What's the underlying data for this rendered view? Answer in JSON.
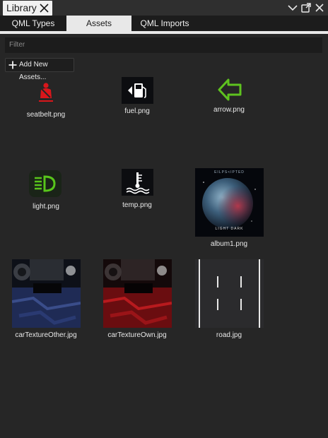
{
  "window": {
    "title": "Library"
  },
  "tabs": [
    {
      "label": "QML Types",
      "active": false
    },
    {
      "label": "Assets",
      "active": true
    },
    {
      "label": "QML Imports",
      "active": false
    }
  ],
  "filter": {
    "placeholder": "Filter"
  },
  "toolbar": {
    "add_label": "Add New Assets..."
  },
  "assets": [
    {
      "name": "seatbelt.png",
      "icon": "seatbelt-warning-icon"
    },
    {
      "name": "fuel.png",
      "icon": "fuel-icon"
    },
    {
      "name": "arrow.png",
      "icon": "arrow-left-icon"
    },
    {
      "name": "light.png",
      "icon": "headlight-icon"
    },
    {
      "name": "temp.png",
      "icon": "temperature-icon"
    },
    {
      "name": "album1.png",
      "icon": "album-cover-image",
      "album_text_top": "EILPS<IPTED",
      "album_text_bottom": "LIGHT DARK"
    },
    {
      "name": "carTextureOther.jpg",
      "icon": "car-texture-blue-image"
    },
    {
      "name": "carTextureOwn.jpg",
      "icon": "car-texture-red-image"
    },
    {
      "name": "road.jpg",
      "icon": "road-texture-image"
    }
  ],
  "colors": {
    "background": "#262626",
    "tab_active": "#e8e8e8",
    "seatbelt_red": "#d9161b",
    "arrow_green": "#5ec21f",
    "light_green": "#58c51b"
  }
}
